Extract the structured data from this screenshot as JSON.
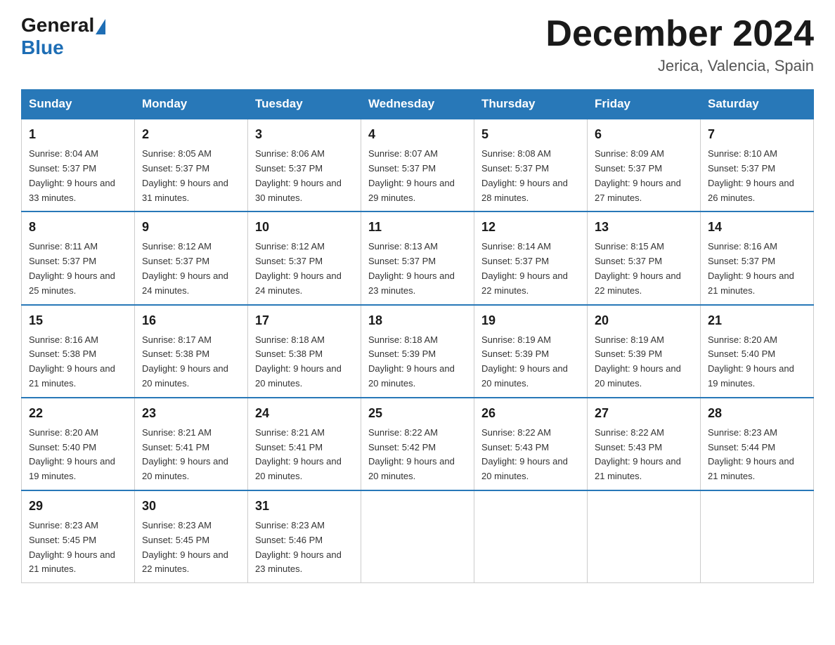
{
  "header": {
    "logo": {
      "general": "General",
      "blue": "Blue"
    },
    "title": "December 2024",
    "location": "Jerica, Valencia, Spain"
  },
  "days_of_week": [
    "Sunday",
    "Monday",
    "Tuesday",
    "Wednesday",
    "Thursday",
    "Friday",
    "Saturday"
  ],
  "weeks": [
    [
      {
        "day": "1",
        "sunrise": "8:04 AM",
        "sunset": "5:37 PM",
        "daylight": "9 hours and 33 minutes."
      },
      {
        "day": "2",
        "sunrise": "8:05 AM",
        "sunset": "5:37 PM",
        "daylight": "9 hours and 31 minutes."
      },
      {
        "day": "3",
        "sunrise": "8:06 AM",
        "sunset": "5:37 PM",
        "daylight": "9 hours and 30 minutes."
      },
      {
        "day": "4",
        "sunrise": "8:07 AM",
        "sunset": "5:37 PM",
        "daylight": "9 hours and 29 minutes."
      },
      {
        "day": "5",
        "sunrise": "8:08 AM",
        "sunset": "5:37 PM",
        "daylight": "9 hours and 28 minutes."
      },
      {
        "day": "6",
        "sunrise": "8:09 AM",
        "sunset": "5:37 PM",
        "daylight": "9 hours and 27 minutes."
      },
      {
        "day": "7",
        "sunrise": "8:10 AM",
        "sunset": "5:37 PM",
        "daylight": "9 hours and 26 minutes."
      }
    ],
    [
      {
        "day": "8",
        "sunrise": "8:11 AM",
        "sunset": "5:37 PM",
        "daylight": "9 hours and 25 minutes."
      },
      {
        "day": "9",
        "sunrise": "8:12 AM",
        "sunset": "5:37 PM",
        "daylight": "9 hours and 24 minutes."
      },
      {
        "day": "10",
        "sunrise": "8:12 AM",
        "sunset": "5:37 PM",
        "daylight": "9 hours and 24 minutes."
      },
      {
        "day": "11",
        "sunrise": "8:13 AM",
        "sunset": "5:37 PM",
        "daylight": "9 hours and 23 minutes."
      },
      {
        "day": "12",
        "sunrise": "8:14 AM",
        "sunset": "5:37 PM",
        "daylight": "9 hours and 22 minutes."
      },
      {
        "day": "13",
        "sunrise": "8:15 AM",
        "sunset": "5:37 PM",
        "daylight": "9 hours and 22 minutes."
      },
      {
        "day": "14",
        "sunrise": "8:16 AM",
        "sunset": "5:37 PM",
        "daylight": "9 hours and 21 minutes."
      }
    ],
    [
      {
        "day": "15",
        "sunrise": "8:16 AM",
        "sunset": "5:38 PM",
        "daylight": "9 hours and 21 minutes."
      },
      {
        "day": "16",
        "sunrise": "8:17 AM",
        "sunset": "5:38 PM",
        "daylight": "9 hours and 20 minutes."
      },
      {
        "day": "17",
        "sunrise": "8:18 AM",
        "sunset": "5:38 PM",
        "daylight": "9 hours and 20 minutes."
      },
      {
        "day": "18",
        "sunrise": "8:18 AM",
        "sunset": "5:39 PM",
        "daylight": "9 hours and 20 minutes."
      },
      {
        "day": "19",
        "sunrise": "8:19 AM",
        "sunset": "5:39 PM",
        "daylight": "9 hours and 20 minutes."
      },
      {
        "day": "20",
        "sunrise": "8:19 AM",
        "sunset": "5:39 PM",
        "daylight": "9 hours and 20 minutes."
      },
      {
        "day": "21",
        "sunrise": "8:20 AM",
        "sunset": "5:40 PM",
        "daylight": "9 hours and 19 minutes."
      }
    ],
    [
      {
        "day": "22",
        "sunrise": "8:20 AM",
        "sunset": "5:40 PM",
        "daylight": "9 hours and 19 minutes."
      },
      {
        "day": "23",
        "sunrise": "8:21 AM",
        "sunset": "5:41 PM",
        "daylight": "9 hours and 20 minutes."
      },
      {
        "day": "24",
        "sunrise": "8:21 AM",
        "sunset": "5:41 PM",
        "daylight": "9 hours and 20 minutes."
      },
      {
        "day": "25",
        "sunrise": "8:22 AM",
        "sunset": "5:42 PM",
        "daylight": "9 hours and 20 minutes."
      },
      {
        "day": "26",
        "sunrise": "8:22 AM",
        "sunset": "5:43 PM",
        "daylight": "9 hours and 20 minutes."
      },
      {
        "day": "27",
        "sunrise": "8:22 AM",
        "sunset": "5:43 PM",
        "daylight": "9 hours and 21 minutes."
      },
      {
        "day": "28",
        "sunrise": "8:23 AM",
        "sunset": "5:44 PM",
        "daylight": "9 hours and 21 minutes."
      }
    ],
    [
      {
        "day": "29",
        "sunrise": "8:23 AM",
        "sunset": "5:45 PM",
        "daylight": "9 hours and 21 minutes."
      },
      {
        "day": "30",
        "sunrise": "8:23 AM",
        "sunset": "5:45 PM",
        "daylight": "9 hours and 22 minutes."
      },
      {
        "day": "31",
        "sunrise": "8:23 AM",
        "sunset": "5:46 PM",
        "daylight": "9 hours and 23 minutes."
      },
      null,
      null,
      null,
      null
    ]
  ]
}
